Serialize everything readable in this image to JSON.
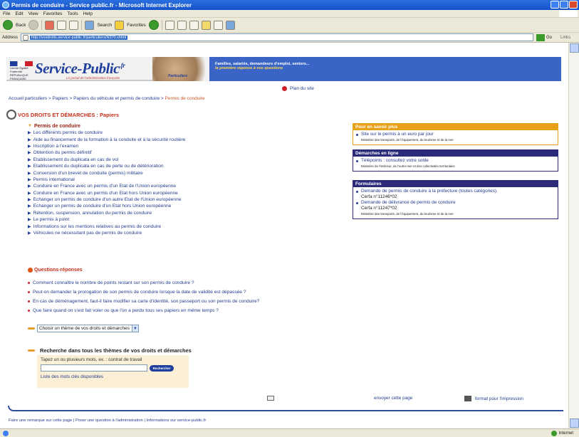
{
  "window": {
    "title": "Permis de conduire - Service public.fr - Microsoft Internet Explorer"
  },
  "menu": [
    "File",
    "Edit",
    "View",
    "Favorites",
    "Tools",
    "Help"
  ],
  "toolbar": {
    "back": "Back",
    "search": "Search",
    "favorites": "Favorites"
  },
  "address": {
    "label": "Address",
    "url": "http://vosdroits.service-public.fr/particuliers/N370.xhtml",
    "go": "Go",
    "links": "Links"
  },
  "banner": {
    "logo": "Service-Public",
    "logo_suffix": ".fr",
    "logo_tagline": "Le portail de l'administration française",
    "rf_text": "Liberté Égalité Fraternité RÉPUBLIQUE FRANÇAISE",
    "photo_label": "Particuliers",
    "line1": "Familles, salariés, demandeurs d'emploi, seniors...",
    "line2": "la première réponse à vos questions"
  },
  "plan_site": "Plan du site",
  "breadcrumb": {
    "items": [
      "Accueil particuliers",
      "Papiers",
      "Papiers du véhicule et permis de conduire"
    ],
    "current": "Permis de conduire",
    "sep": " > "
  },
  "section_title": "VOS DROITS ET DÉMARCHES : Papiers",
  "main": {
    "heading": "Permis de conduire",
    "items": [
      "Les différents permis de conduire",
      "Aide au financement de la formation à la conduite et à la sécurité routière",
      "Inscription à l'examen",
      "Obtention du permis définitif",
      "Etablissement du duplicata en cas de vol",
      "Etablissement du duplicata en cas de perte ou de détérioration",
      "Conversion d'un brevet de conduite (permis) militaire",
      "Permis international",
      "Conduire en France avec un permis d'un Etat de l'Union européenne",
      "Conduire en France avec un permis d'un Etat hors Union européenne",
      "Echanger un permis de conduire d'un autre Etat de l'Union européenne",
      "Echanger un permis de conduire d'un Etat hors Union européenne",
      "Rétention, suspension, annulation du permis de conduire",
      "Le permis à point",
      "Informations sur les mentions relatives au permis de conduire",
      "Véhicules ne nécessitant pas de permis de conduire"
    ]
  },
  "qr": {
    "title": "Questions-réponses",
    "items": [
      "Comment connaître le nombre de points restant sur son permis de conduire ?",
      "Peut-on demander la prorogation de son permis de conduire lorsque la date de validité est dépassée ?",
      "En cas de déménagement, faut-il faire modifier sa carte d'identité, son passeport ou son permis de conduire?",
      "Que faire quand on s'est fait voler ou que l'on a perdu tous ses papiers en même temps ?"
    ]
  },
  "theme_select": {
    "value": "Choisir un thème de vos droits et démarches"
  },
  "search": {
    "heading": "Recherche dans tous les thèmes de vos droits et démarches",
    "hint": "Tapez un ou plusieurs mots, ex. : contrat de travail",
    "button": "Rechercher",
    "keywords_link": "Liste des mots clés disponibles"
  },
  "bottom": {
    "send": "envoyer cette page",
    "print": "format pour l'impression"
  },
  "footer": "Faire une remarque sur cette page | Poser une question à l'administration | Informations sur service-public.fr",
  "right": {
    "pour_en_savoir": {
      "title": "Pour en savoir plus",
      "link": "Site sur le permis à un euro par jour",
      "source": "Ministère des transports, de l'équipement, du tourisme et de la mer"
    },
    "demarches": {
      "title": "Démarches en ligne",
      "link": "Télépoints : consultez votre solde",
      "source": "Ministère de l'intérieur, de l'outre-mer et des collectivités territoriales"
    },
    "formulaires": {
      "title": "Formulaires",
      "f1": "Demande de permis de conduire à la préfecture (toutes catégories).",
      "f1_cerfa": "Cerfa n°11246*02",
      "f2": "Demande de délivrance de permis de conduire",
      "f2_cerfa": "Cerfa n°11247*02",
      "source": "Ministère des transports, de l'équipement, du tourisme et de la mer"
    }
  },
  "status": {
    "zone": "Internet"
  },
  "colors": {
    "brand_blue": "#1f3f9c",
    "banner_blue": "#3a64c6",
    "orange": "#e8a219",
    "red": "#c5301a"
  }
}
